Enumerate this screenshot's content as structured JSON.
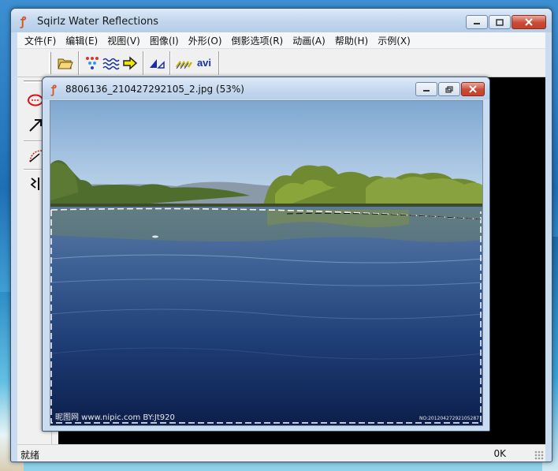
{
  "window": {
    "title": "Sqirlz Water Reflections"
  },
  "menu": [
    "文件(F)",
    "编辑(E)",
    "视图(V)",
    "图像(I)",
    "外形(O)",
    "倒影选项(R)",
    "动画(A)",
    "帮助(H)",
    "示例(X)"
  ],
  "toolbar": {
    "avi_label": "avi",
    "icons": [
      "open-folder-icon",
      "color-dots-icon",
      "waves-icon",
      "arrow-right-icon",
      "triangle-ramp-icon",
      "ripple-lines-icon",
      "avi-export-icon"
    ]
  },
  "left_tools": [
    "ellipse-tool-icon",
    "arrow-tool-icon",
    "curve-tool-icon",
    "split-tool-icon"
  ],
  "child": {
    "title": "8806136_210427292105_2.jpg  (53%)"
  },
  "photo": {
    "watermark_left": "昵图网 www.nipic.com  BY:Jt920",
    "watermark_right": "NO:20120427292105287"
  },
  "status": {
    "left": "就绪",
    "right": "0K"
  },
  "colors": {
    "accent": "#d2572a",
    "close_red": "#c94a36"
  }
}
